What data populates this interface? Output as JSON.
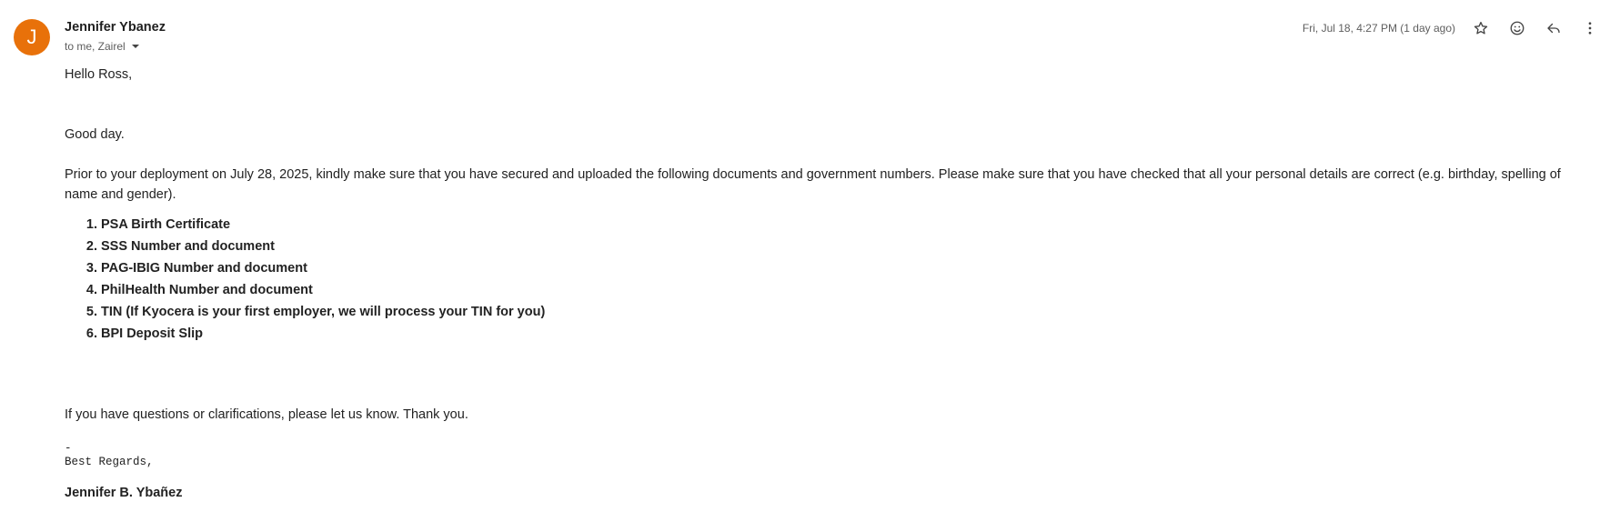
{
  "sender": {
    "avatar_letter": "J",
    "avatar_color": "#e8710a",
    "name": "Jennifer Ybanez",
    "recipients": "to me, Zairel"
  },
  "header": {
    "timestamp": "Fri, Jul 18, 4:27 PM (1 day ago)",
    "actions": [
      {
        "name": "star-icon"
      },
      {
        "name": "emoji-icon"
      },
      {
        "name": "reply-icon"
      },
      {
        "name": "more-vert-icon"
      }
    ]
  },
  "email": {
    "greeting": "Hello Ross,",
    "good_day": "Good day.",
    "intro": "Prior to your deployment on July 28, 2025, kindly make sure that you have secured and uploaded the following documents and government numbers. Please make sure that you have checked that all your personal details are correct (e.g. birthday, spelling of name and gender).",
    "documents": [
      "PSA Birth Certificate",
      "SSS Number and document",
      "PAG-IBIG Number and document",
      "PhilHealth Number and document",
      "TIN (If Kyocera is your first employer, we will process your TIN for you)",
      "BPI Deposit Slip"
    ],
    "closing": "If you have questions or clarifications, please let us know. Thank you.",
    "signature_dash": "-",
    "signature_regards": "Best Regards,",
    "signature_name": "Jennifer B. Ybañez"
  }
}
